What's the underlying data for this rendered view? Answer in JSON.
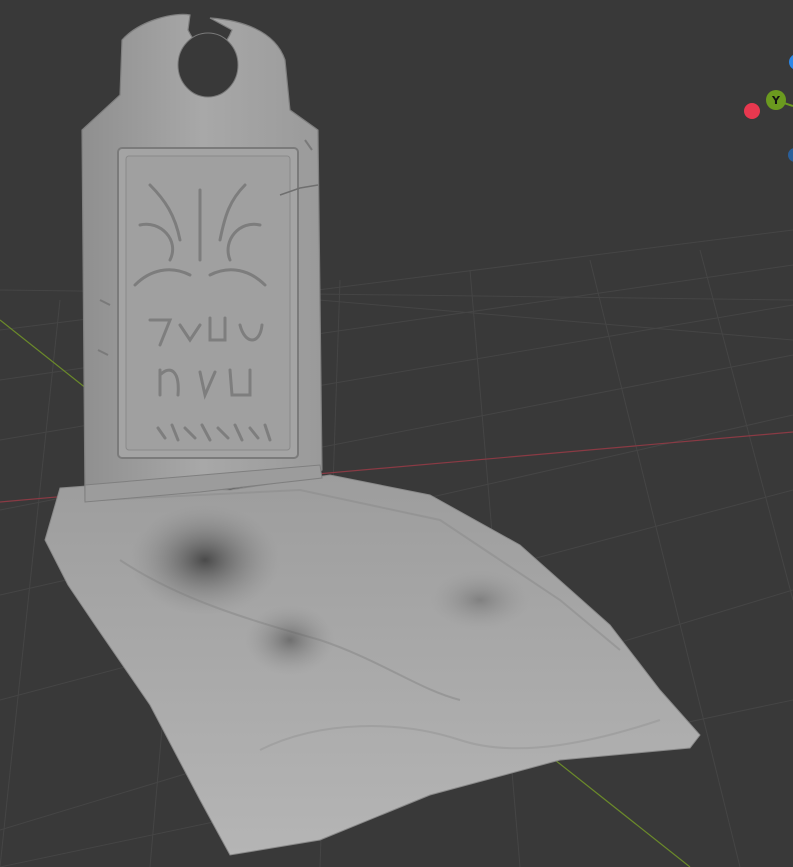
{
  "viewport": {
    "background": "#393939",
    "grid_color": "#454545",
    "x_axis_color": "#8a3a44",
    "y_axis_color": "#6b8a2a"
  },
  "gizmo": {
    "y_label": "Y",
    "x_color": "#e8384f",
    "y_color": "#6b9a1f",
    "z_color": "#2b87e8",
    "neg_z_color": "#2a5f9a"
  },
  "model": {
    "name": "gravestone",
    "material_color": "#a9a9a9"
  }
}
